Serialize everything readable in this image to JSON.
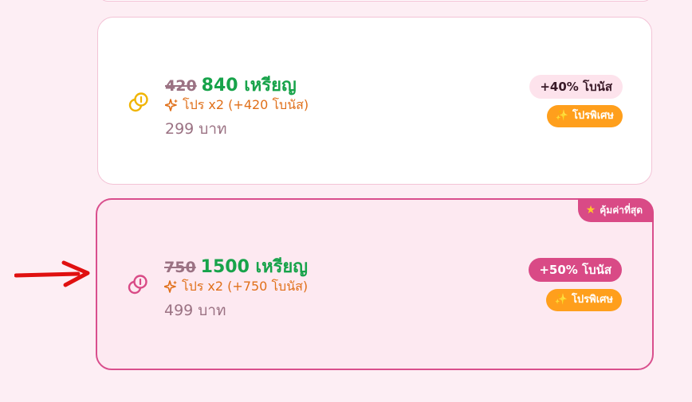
{
  "packages": [
    {
      "old_amount": "420",
      "new_amount": "840 เหรียญ",
      "promo_text": "โปร x2 (+420 โบนัส)",
      "price": "299 บาท",
      "bonus_label": "+40% โบนัส",
      "special_label": "โปรพิเศษ",
      "coin_icon": "coin-icon",
      "coin_color": "#f0b400"
    },
    {
      "old_amount": "750",
      "new_amount": "1500 เหรียญ",
      "promo_text": "โปร x2 (+750 โบนัส)",
      "price": "499 บาท",
      "bonus_label": "+50% โบนัส",
      "special_label": "โปรพิเศษ",
      "best_value_label": "คุ้มค่าที่สุด",
      "coin_icon": "coin-icon",
      "coin_color": "#d94a86",
      "selected": true
    }
  ],
  "colors": {
    "accent_pink": "#d94a86",
    "promo_orange": "#e0701a",
    "amount_green": "#17a34a",
    "special_orange": "#ff9f1c",
    "arrow_red": "#e01010"
  }
}
